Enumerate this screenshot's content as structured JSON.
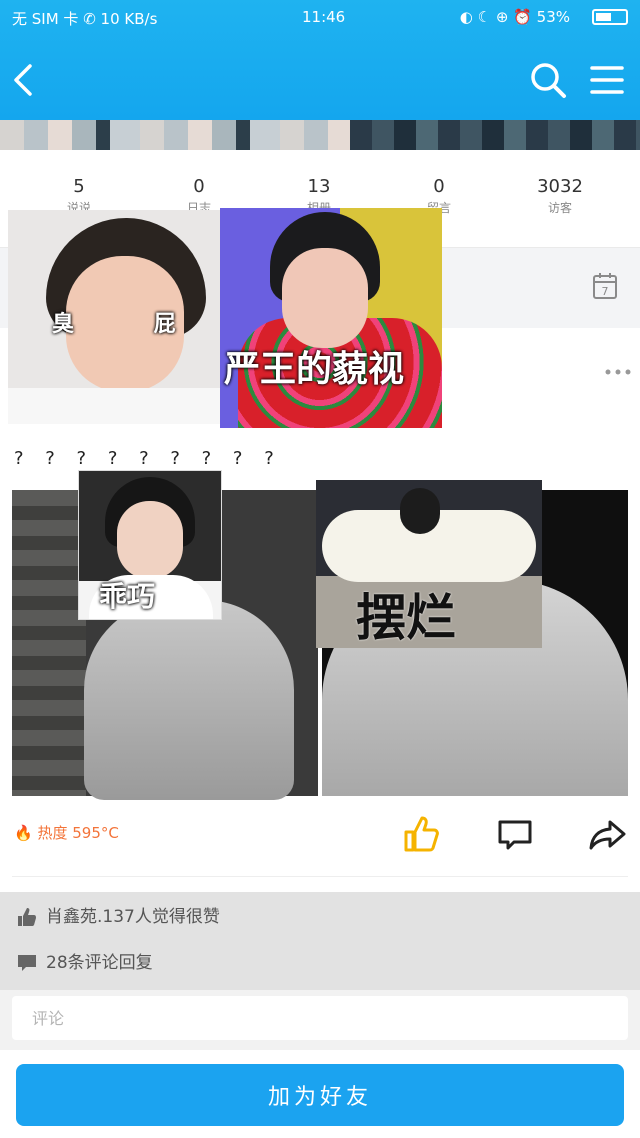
{
  "status_bar": {
    "left": "无 SIM 卡 ✆ 10 KB/s",
    "time": "11:46",
    "right": "◐ ☾ ⊕ ⏰ 53%",
    "battery_percent": 53
  },
  "header": {
    "back_icon": "chevron-left-icon",
    "search_icon": "search-icon",
    "menu_icon": "hamburger-menu-icon",
    "bg_color": "#14a6ee"
  },
  "stats": [
    {
      "value": "5",
      "label": "说说"
    },
    {
      "value": "0",
      "label": "日志"
    },
    {
      "value": "13",
      "label": "相册"
    },
    {
      "value": "0",
      "label": "留言"
    },
    {
      "value": "3032",
      "label": "访客"
    }
  ],
  "memes": {
    "meme1": "臭 屁",
    "meme2": "严王的藐视",
    "meme3": "乖巧",
    "meme4": "摆烂"
  },
  "post": {
    "text": "? ? ? ? ? ? ? ? ?",
    "heat": "热度 595°C",
    "likes_text": "肖鑫苑.137人觉得很赞",
    "comments_text": "28条评论回复"
  },
  "comment": {
    "placeholder": "评论"
  },
  "footer": {
    "add_friend_label": "加为好友"
  },
  "colors": {
    "accent": "#1ba3f0",
    "heat": "#f3743a",
    "like": "#f5b300"
  }
}
